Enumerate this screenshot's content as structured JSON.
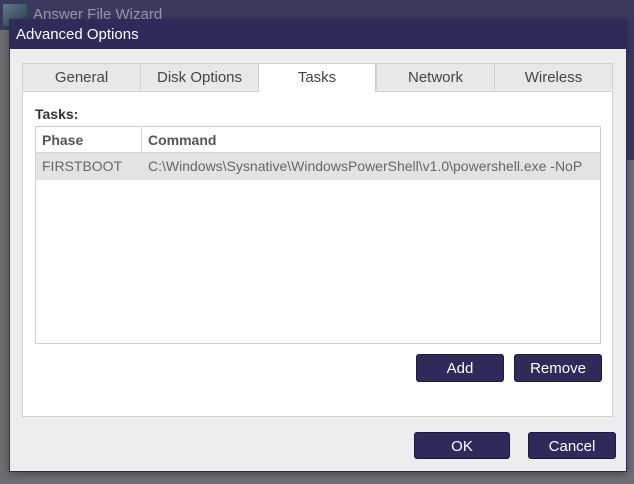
{
  "parent_window": {
    "title": "Answer File Wizard"
  },
  "dialog": {
    "title": "Advanced Options",
    "tabs": [
      {
        "label": "General"
      },
      {
        "label": "Disk Options"
      },
      {
        "label": "Tasks",
        "active": true
      },
      {
        "label": "Network"
      },
      {
        "label": "Wireless"
      }
    ],
    "tasks_label": "Tasks:",
    "grid": {
      "columns": [
        "Phase",
        "Command"
      ],
      "rows": [
        {
          "phase": "FIRSTBOOT",
          "command": "C:\\Windows\\Sysnative\\WindowsPowerShell\\v1.0\\powershell.exe -NoP"
        }
      ]
    },
    "buttons": {
      "add": "Add",
      "remove": "Remove",
      "ok": "OK",
      "cancel": "Cancel"
    }
  },
  "colors": {
    "accent": "#2e2a5a",
    "selected_row": "#e3e3e3",
    "backdrop": "#6f6f73"
  }
}
